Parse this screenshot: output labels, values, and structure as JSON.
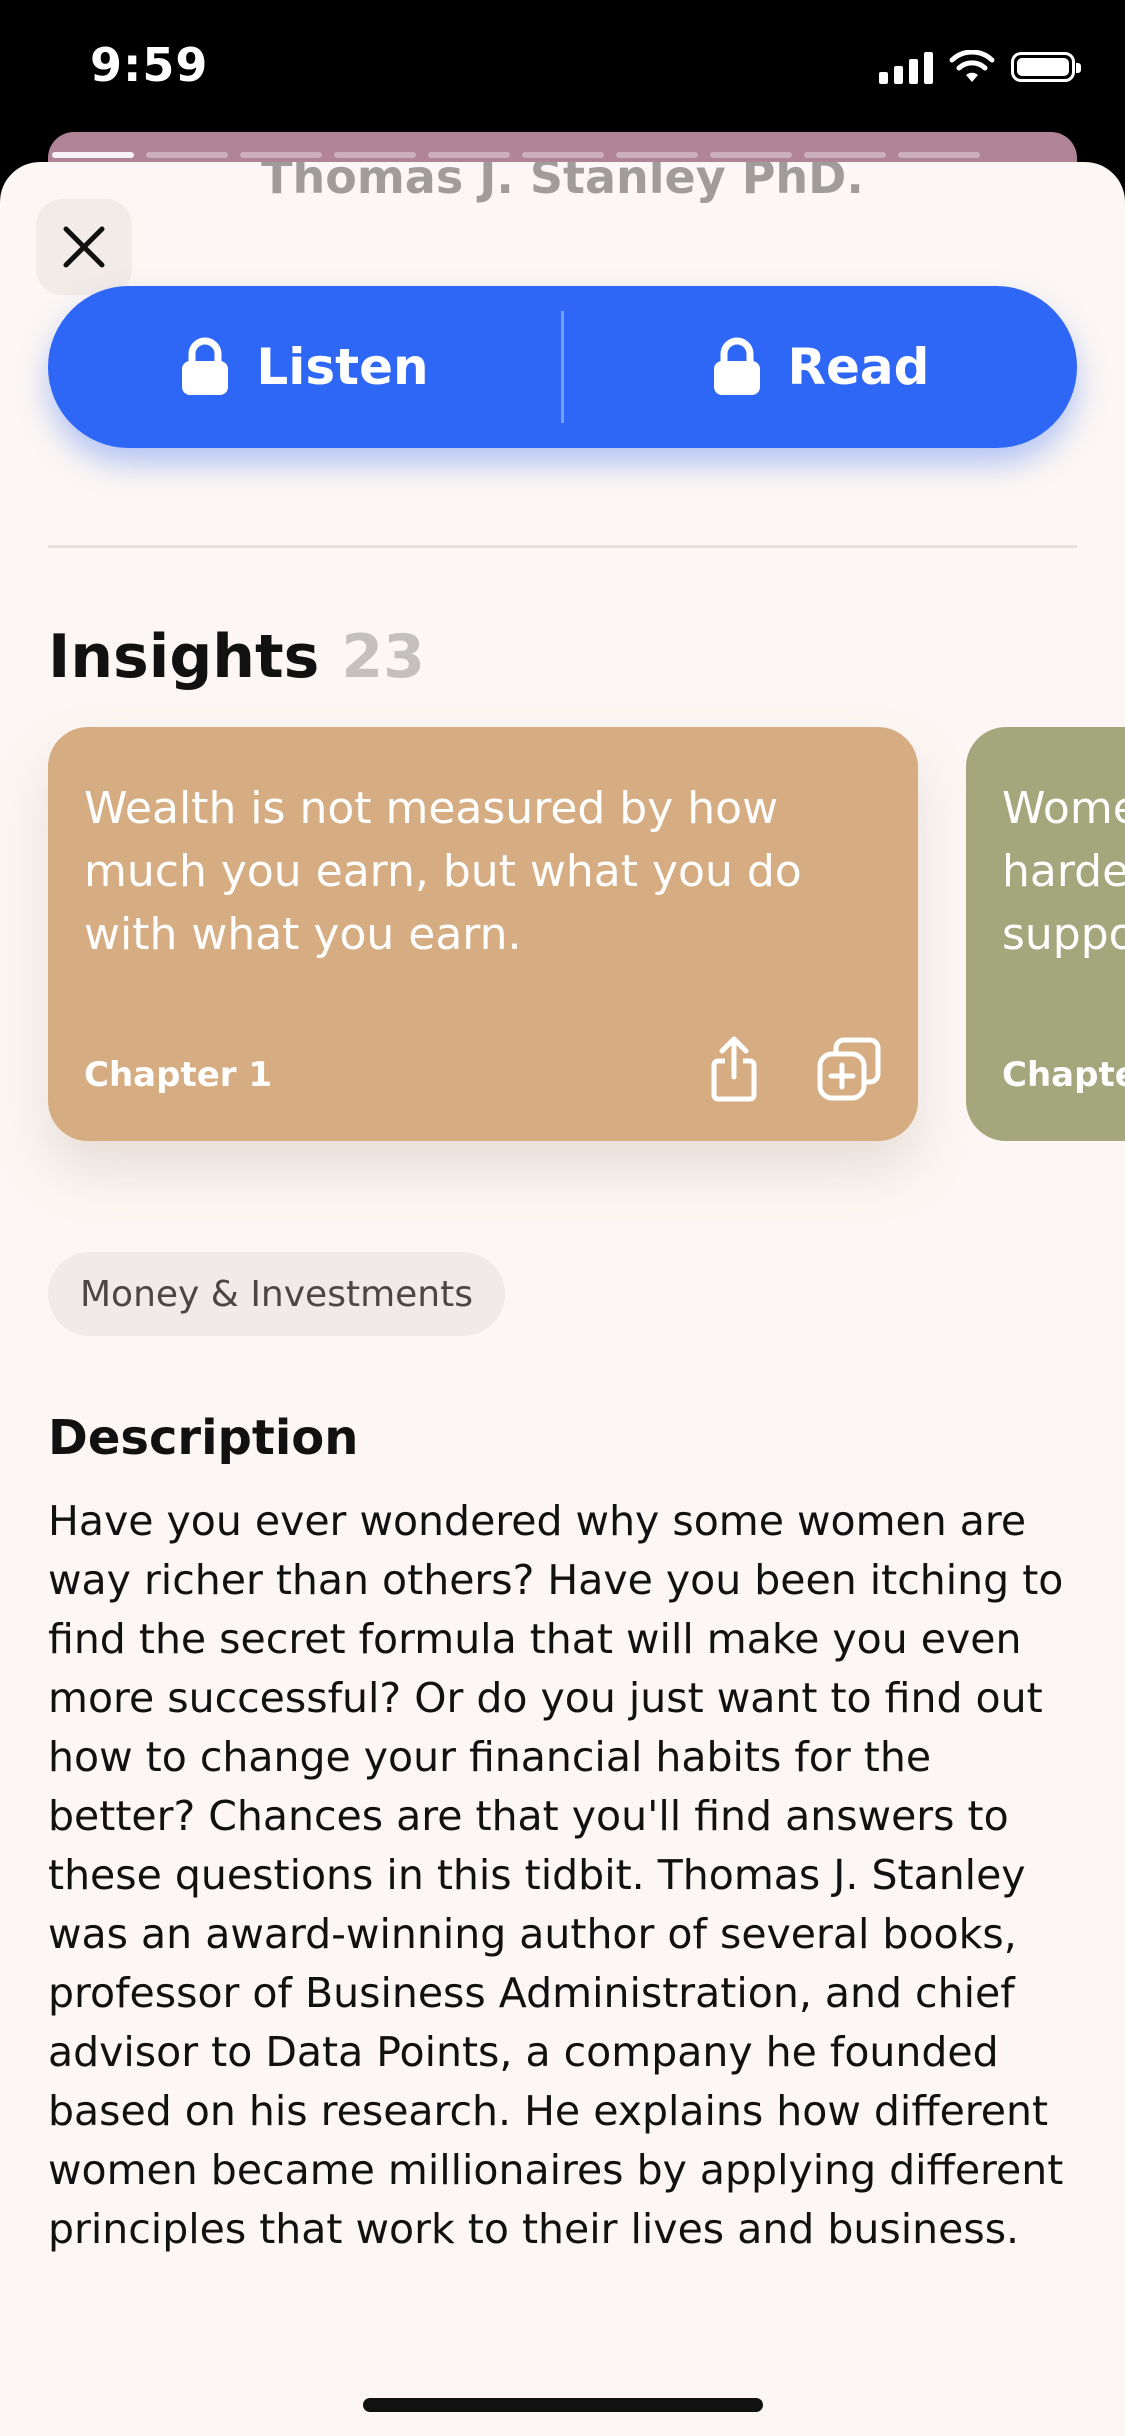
{
  "status_bar": {
    "time": "9:59"
  },
  "book": {
    "author": "Thomas J. Stanley PhD."
  },
  "actions": {
    "listen_label": "Listen",
    "read_label": "Read"
  },
  "insights": {
    "heading": "Insights",
    "count": "23",
    "cards": [
      {
        "quote": "Wealth is not measured by how much you earn, but what you do with what you earn.",
        "chapter": "Chapter 1",
        "color": "#d6ad82"
      },
      {
        "quote": "Wome harde suppo",
        "chapter": "Chapte",
        "color": "#a4a67c"
      }
    ]
  },
  "category_tag": "Money & Investments",
  "description": {
    "heading": "Description",
    "text": "Have you ever wondered why some women are way richer than others? Have you been itching to find the secret formula that will make you even more successful? Or do you just want to find out how to change your financial habits for the better? Chances are that you'll find answers to these questions in this tidbit. Thomas J. Stanley was an award-winning author of several books, professor of Business Administration, and chief advisor to Data Points, a company he founded based on his research. He explains how different women became millionaires by applying different principles that work to their lives and business."
  },
  "colors": {
    "primary": "#2e66f5",
    "background": "#fcf7f4"
  },
  "icons": [
    "close-icon",
    "lock-icon",
    "share-icon",
    "add-to-library-icon"
  ]
}
